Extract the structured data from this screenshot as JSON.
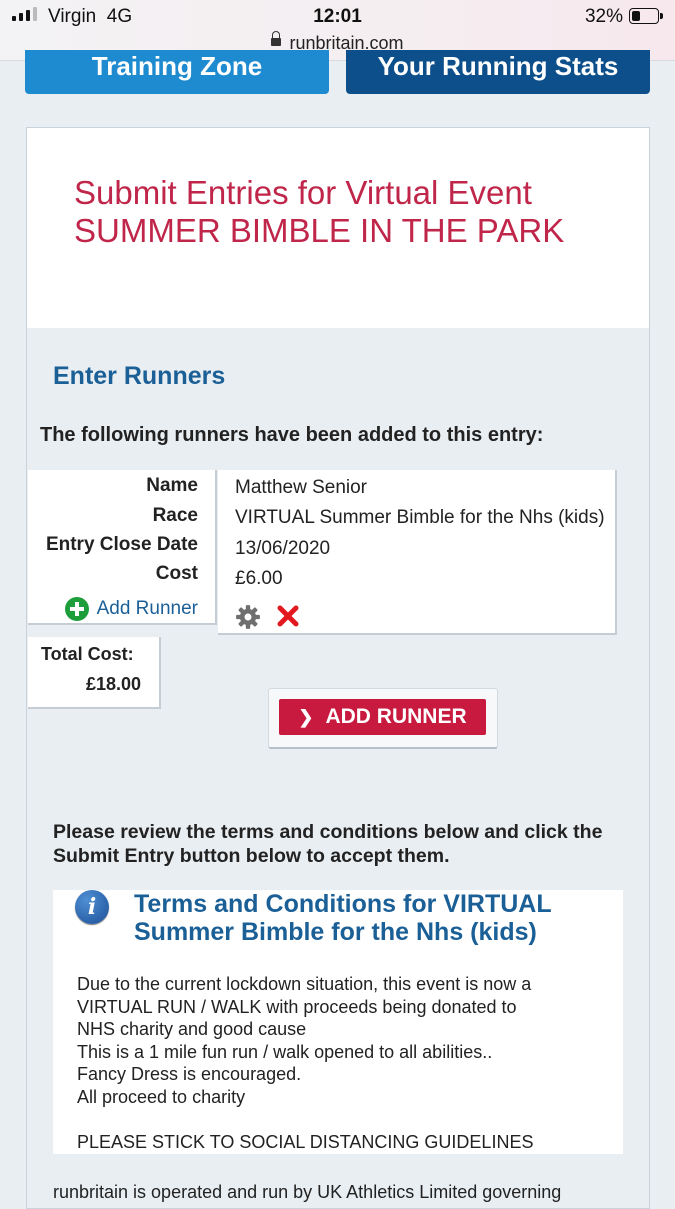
{
  "status_bar": {
    "carrier": "Virgin",
    "network": "4G",
    "time": "12:01",
    "battery": "32%",
    "battery_level": 0.32,
    "url": "runbritain.com"
  },
  "nav": {
    "training_zone": "Training Zone",
    "running_stats": "Your Running Stats"
  },
  "page": {
    "title_line1": "Submit Entries for Virtual Event",
    "title_line2": "SUMMER BIMBLE IN THE PARK"
  },
  "entry": {
    "heading": "Enter Runners",
    "added_text": "The following runners have been added to this entry:",
    "labels": {
      "name": "Name",
      "race": "Race",
      "close_date": "Entry Close Date",
      "cost": "Cost",
      "add_runner": "Add Runner"
    },
    "runner": {
      "name": "Matthew Senior",
      "race": "VIRTUAL Summer Bimble for the Nhs (kids)",
      "close_date": "13/06/2020",
      "cost": "£6.00"
    },
    "total_label": "Total Cost:",
    "total_value": "£18.00",
    "add_runner_button": "ADD RUNNER"
  },
  "review_text": "Please review the terms and conditions below and click the Submit Entry button below to accept them.",
  "terms": {
    "title_line1": "Terms and Conditions for VIRTUAL",
    "title_line2": "Summer Bimble for the Nhs (kids)",
    "lines": [
      "Due to the current lockdown situation, this event is now a",
      "VIRTUAL RUN / WALK with proceeds being donated to",
      "NHS charity and good cause",
      "This is a 1 mile fun run / walk opened to all abilities..",
      "Fancy Dress is encouraged.",
      "All proceed to charity",
      "",
      "PLEASE STICK TO SOCIAL DISTANCING GUIDELINES"
    ]
  },
  "footer_text": "runbritain is operated and run by UK Athletics Limited governing",
  "colors": {
    "title_red": "#c0264a",
    "heading_blue": "#1b5f97",
    "button_red": "#c8193f",
    "nav_light_blue": "#1e8ad0",
    "nav_dark_blue": "#0c4f8b"
  }
}
